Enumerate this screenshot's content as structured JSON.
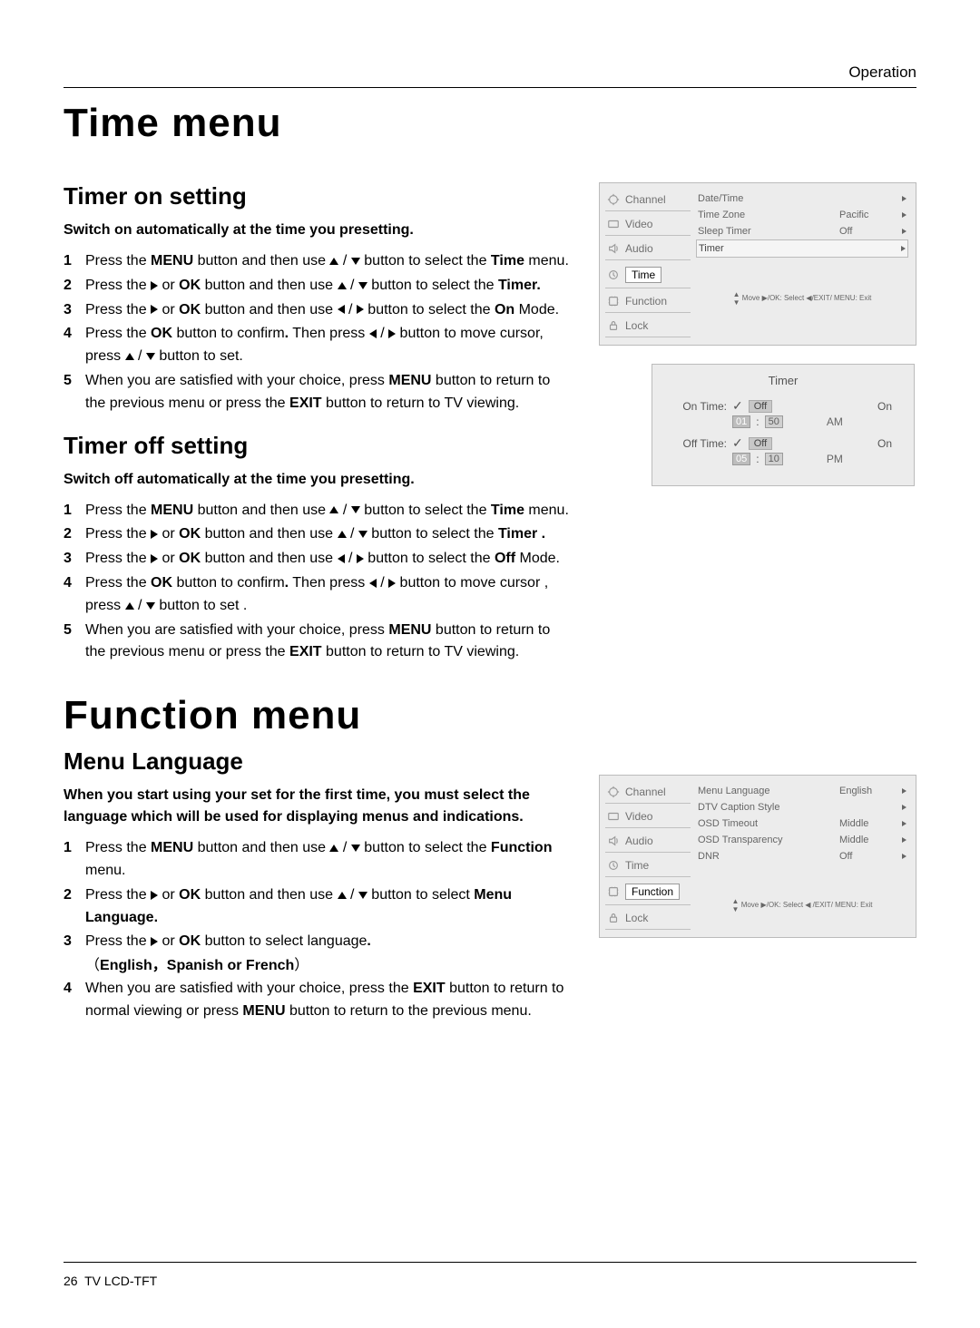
{
  "header": {
    "section": "Operation"
  },
  "h1_time": "Time menu",
  "section_on": {
    "title": "Timer on setting",
    "subtitle": "Switch on automatically at the time you presetting.",
    "steps": [
      [
        "Press the ",
        "MENU",
        " button and then use ",
        "UD",
        " button to select the ",
        "Time",
        " menu."
      ],
      [
        "Press the ",
        "R",
        " or ",
        "OK",
        " button and then use ",
        "UD",
        " button to select the ",
        "Timer.",
        ""
      ],
      [
        "Press the ",
        "R",
        " or ",
        "OK",
        " button and then use ",
        "LR",
        " button to select the ",
        "On",
        " Mode."
      ],
      [
        "Press the ",
        "OK",
        " button to confirm",
        ".",
        " Then press ",
        "LR",
        " button to move cursor, press ",
        "UD",
        " button to set."
      ],
      [
        "When you are satisfied with your choice,  press ",
        "MENU",
        " button to return to the previous menu or press the ",
        "EXIT",
        " button to return to TV viewing."
      ]
    ]
  },
  "section_off": {
    "title": "Timer off setting",
    "subtitle": "Switch off automatically at the time you presetting.",
    "steps": [
      [
        "Press the ",
        "MENU",
        " button and then use ",
        "UD",
        " button to select the ",
        "Time",
        " menu."
      ],
      [
        "Press the ",
        "R",
        " or ",
        "OK",
        "  button and then use ",
        "UD",
        " button to select the ",
        "Timer .",
        ""
      ],
      [
        "Press the ",
        "R",
        " or ",
        "OK",
        " button and then use ",
        "LR",
        " button to select  the ",
        "Off",
        " Mode."
      ],
      [
        "Press the ",
        "OK",
        " button to confirm",
        ".",
        " Then press ",
        "LR",
        " button to move cursor , press ",
        "UD",
        " button to set ."
      ],
      [
        "When you are satisfied with your choice,  press ",
        "MENU",
        " button to return to the previous menu or press the ",
        "EXIT",
        " button to return to TV viewing."
      ]
    ]
  },
  "h1_function": "Function menu",
  "section_lang": {
    "title": "Menu Language",
    "subtitle": "When you start using your set for the first time, you must select the language which will be used for displaying menus and indications.",
    "steps": [
      [
        "Press the ",
        "MENU",
        " button and then use ",
        "UD",
        " button to select the ",
        "Function",
        " menu."
      ],
      [
        "Press the ",
        "R",
        "  or ",
        "OK",
        " button and then use ",
        "UD",
        " button to select ",
        "Menu Language.",
        ""
      ],
      [
        "Press the ",
        "R",
        " or ",
        "OK",
        "  button  to select  language",
        ".",
        ""
      ],
      [
        "When you are satisfied with your choice, press the ",
        "EXIT",
        " button to return to normal viewing or press ",
        "MENU",
        " button to return to the previous menu."
      ]
    ],
    "lang_note_open": "（",
    "lang_note": "English，Spanish or French",
    "lang_note_close": "）"
  },
  "osd_tabs": [
    "Channel",
    "Video",
    "Audio",
    "Time",
    "Function",
    "Lock"
  ],
  "osd_time": {
    "rows": [
      {
        "label": "Date/Time",
        "value": "",
        "arrow": true
      },
      {
        "label": "Time Zone",
        "value": "Pacific",
        "arrow": true
      },
      {
        "label": "Sleep Timer",
        "value": "Off",
        "arrow": true
      },
      {
        "label": "Timer",
        "value": "",
        "arrow": true,
        "outlined": true
      }
    ],
    "footer": "Move  ▶/OK: Select  ◀/EXIT/ MENU: Exit"
  },
  "timer_dialog": {
    "title": "Timer",
    "on_label": "On Time:",
    "off_label": "Off Time:",
    "off_value": "Off",
    "state": "On",
    "on_hh": "01",
    "on_mm": "50",
    "on_ampm": "AM",
    "off_hh": "05",
    "off_mm": "10",
    "off_ampm": "PM"
  },
  "osd_function": {
    "rows": [
      {
        "label": "Menu Language",
        "value": "English",
        "arrow": true
      },
      {
        "label": "DTV Caption Style",
        "value": "",
        "arrow": true
      },
      {
        "label": "OSD Timeout",
        "value": "Middle",
        "arrow": true
      },
      {
        "label": "OSD Transparency",
        "value": "Middle",
        "arrow": true
      },
      {
        "label": "DNR",
        "value": "Off",
        "arrow": true
      }
    ],
    "footer": "Move  ▶/OK: Select ◀ /EXIT/ MENU: Exit"
  },
  "footer": {
    "page": "26",
    "doc": "TV LCD-TFT"
  }
}
